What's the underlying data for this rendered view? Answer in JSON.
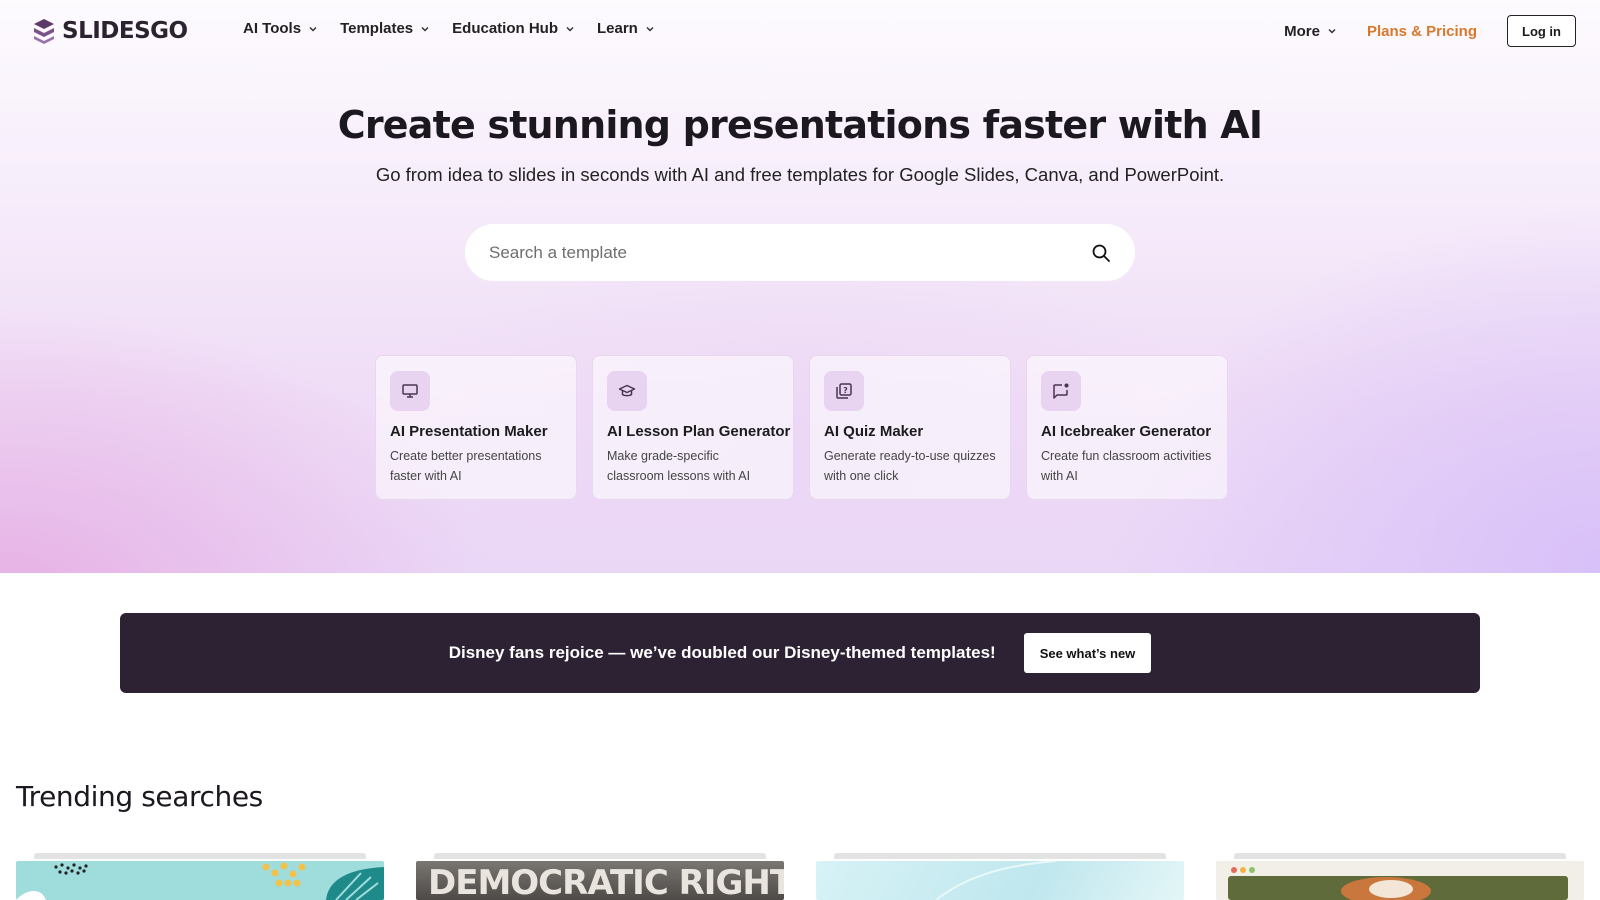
{
  "brand": {
    "name": "SLIDESGO"
  },
  "nav": {
    "items": [
      {
        "label": "AI Tools"
      },
      {
        "label": "Templates"
      },
      {
        "label": "Education Hub"
      },
      {
        "label": "Learn"
      }
    ],
    "more_label": "More",
    "pricing_label": "Plans & Pricing",
    "login_label": "Log in"
  },
  "hero": {
    "title": "Create stunning presentations faster with AI",
    "subtitle": "Go from idea to slides in seconds with AI and free templates for Google Slides, Canva, and PowerPoint.",
    "search_placeholder": "Search a template"
  },
  "tools": [
    {
      "title": "AI Presentation Maker",
      "desc": "Create better presentations faster with AI",
      "icon": "monitor-icon"
    },
    {
      "title": "AI Lesson Plan Generator",
      "desc": "Make grade-specific classroom lessons with AI",
      "icon": "graduation-cap-icon"
    },
    {
      "title": "AI Quiz Maker",
      "desc": "Generate ready-to-use quizzes with one click",
      "icon": "quiz-icon"
    },
    {
      "title": "AI Icebreaker Generator",
      "desc": "Create fun classroom activities with AI",
      "icon": "chat-bubble-icon"
    }
  ],
  "banner": {
    "text": "Disney fans rejoice — we’ve doubled our Disney-themed templates!",
    "button_label": "See what’s new"
  },
  "trending": {
    "title": "Trending searches",
    "thumb2_text": "DEMOCRATIC RIGHTS"
  },
  "colors": {
    "accent_orange": "#d9782c",
    "banner_bg": "#2c2233",
    "icon_tile": "#e8d3f0"
  }
}
